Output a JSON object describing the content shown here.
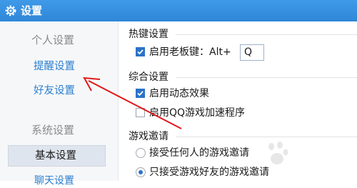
{
  "window": {
    "title": "设置"
  },
  "sidebar": {
    "personal_header": "个人设置",
    "reminder_link": "提醒设置",
    "friends_link": "好友设置",
    "system_header": "系统设置",
    "basic_item": "基本设置",
    "next_item_partial": "聊天设置"
  },
  "hotkey": {
    "title": "热键设置",
    "enable_label": "启用老板键：Alt+",
    "enable_checked": true,
    "key_value": "Q"
  },
  "general": {
    "title": "综合设置",
    "animation_label": "启用动态效果",
    "animation_checked": true,
    "accelerator_label": "启用QQ游戏加速程序",
    "accelerator_checked": false
  },
  "invite": {
    "title": "游戏邀请",
    "anyone_label": "接受任何人的游戏邀请",
    "anyone_selected": false,
    "friends_label": "只接受游戏好友的游戏邀请",
    "friends_selected": true
  },
  "colors": {
    "titlebar": "#2f86d8",
    "link": "#2a7fd0",
    "accent": "#2b73c8",
    "arrow": "#e01818"
  },
  "icons": {
    "title": "gear-icon",
    "annotation": "red-arrow-icon",
    "watermark": "baidu-paw-icon"
  }
}
